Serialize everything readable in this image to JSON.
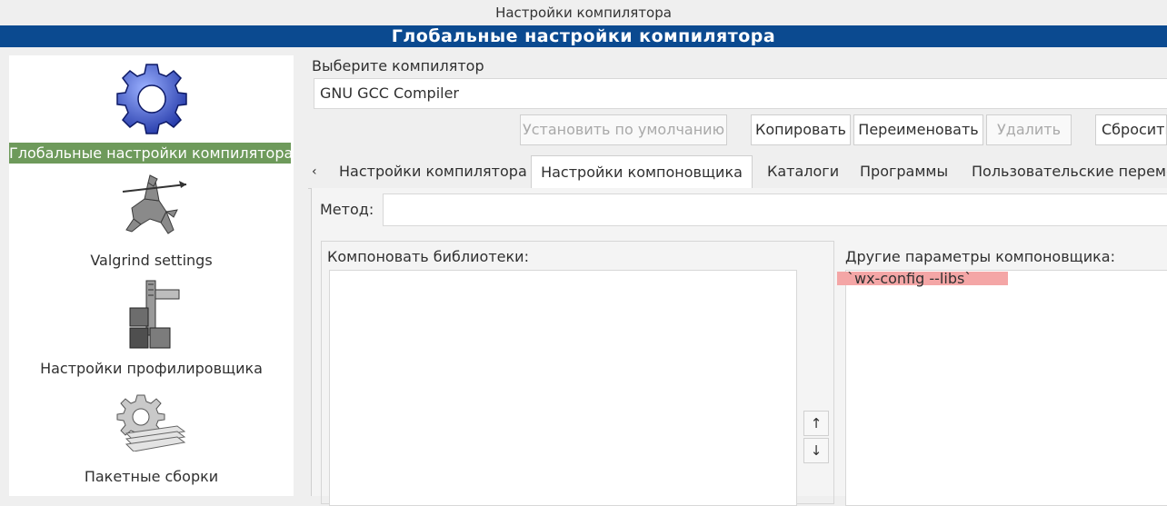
{
  "window": {
    "title": "Настройки компилятора"
  },
  "banner": {
    "title": "Глобальные настройки компилятора"
  },
  "sidebar": {
    "items": [
      {
        "label": "Глобальные настройки компилятора",
        "icon": "gear-icon",
        "selected": true
      },
      {
        "label": "Valgrind settings",
        "icon": "valgrind-knight-icon",
        "selected": false
      },
      {
        "label": "Настройки профилировщика",
        "icon": "caliper-icon",
        "selected": false
      },
      {
        "label": "Пакетные сборки",
        "icon": "batch-gear-icon",
        "selected": false
      }
    ]
  },
  "compiler": {
    "label": "Выберите компилятор",
    "value": "GNU GCC Compiler",
    "buttons": {
      "set_default": "Установить по умолчанию",
      "copy": "Копировать",
      "rename": "Переименовать",
      "delete": "Удалить",
      "reset": "Сбросить"
    }
  },
  "tabs": {
    "scroll_left": "‹",
    "items": [
      {
        "label": "Настройки компилятора",
        "active": false
      },
      {
        "label": "Настройки компоновщика",
        "active": true
      },
      {
        "label": "Каталоги",
        "active": false
      },
      {
        "label": "Программы",
        "active": false
      },
      {
        "label": "Пользовательские переме",
        "active": false
      }
    ]
  },
  "linker": {
    "method_label": "Метод:",
    "method_value": "",
    "libs_label": "Компоновать библиотеки:",
    "other_label": "Другие параметры компоновщика:",
    "other_value": "`wx-config --libs`",
    "move_up": "↑",
    "move_down": "↓"
  },
  "colors": {
    "banner": "#0b4a90",
    "selected": "#6e9a5b",
    "highlight": "#f4a6a6"
  }
}
